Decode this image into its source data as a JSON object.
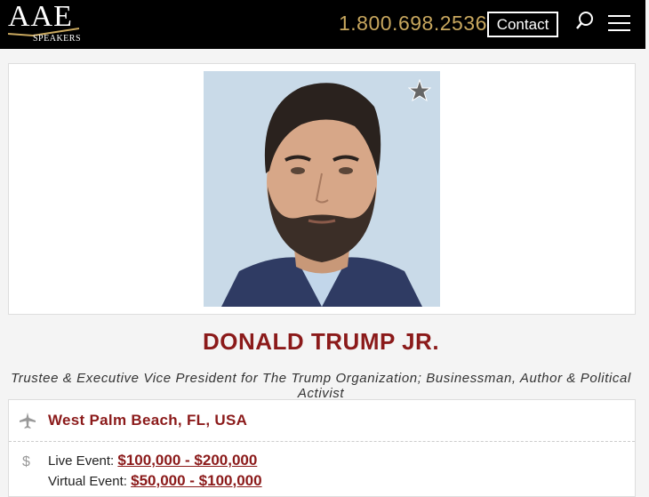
{
  "header": {
    "logo_main": "AAE",
    "logo_sub": "SPEAKERS",
    "phone": "1.800.698.2536",
    "contact_label": "Contact"
  },
  "speaker": {
    "name": "DONALD TRUMP JR.",
    "subtitle": "Trustee & Executive Vice President for The Trump Organization; Businessman, Author & Political Activist",
    "location": "West Palm Beach, FL, USA",
    "fees": {
      "live_label": "Live Event:",
      "live_value": "$100,000 - $200,000",
      "virtual_label": "Virtual Event:",
      "virtual_value": "$50,000 - $100,000"
    }
  },
  "icons": {
    "search": "search-icon",
    "menu": "hamburger-menu-icon",
    "favorite": "star-icon",
    "location": "airplane-icon",
    "fee": "dollar-icon"
  },
  "colors": {
    "accent": "#8b1a1a",
    "gold": "#c8a75e",
    "header_bg": "#000000"
  }
}
